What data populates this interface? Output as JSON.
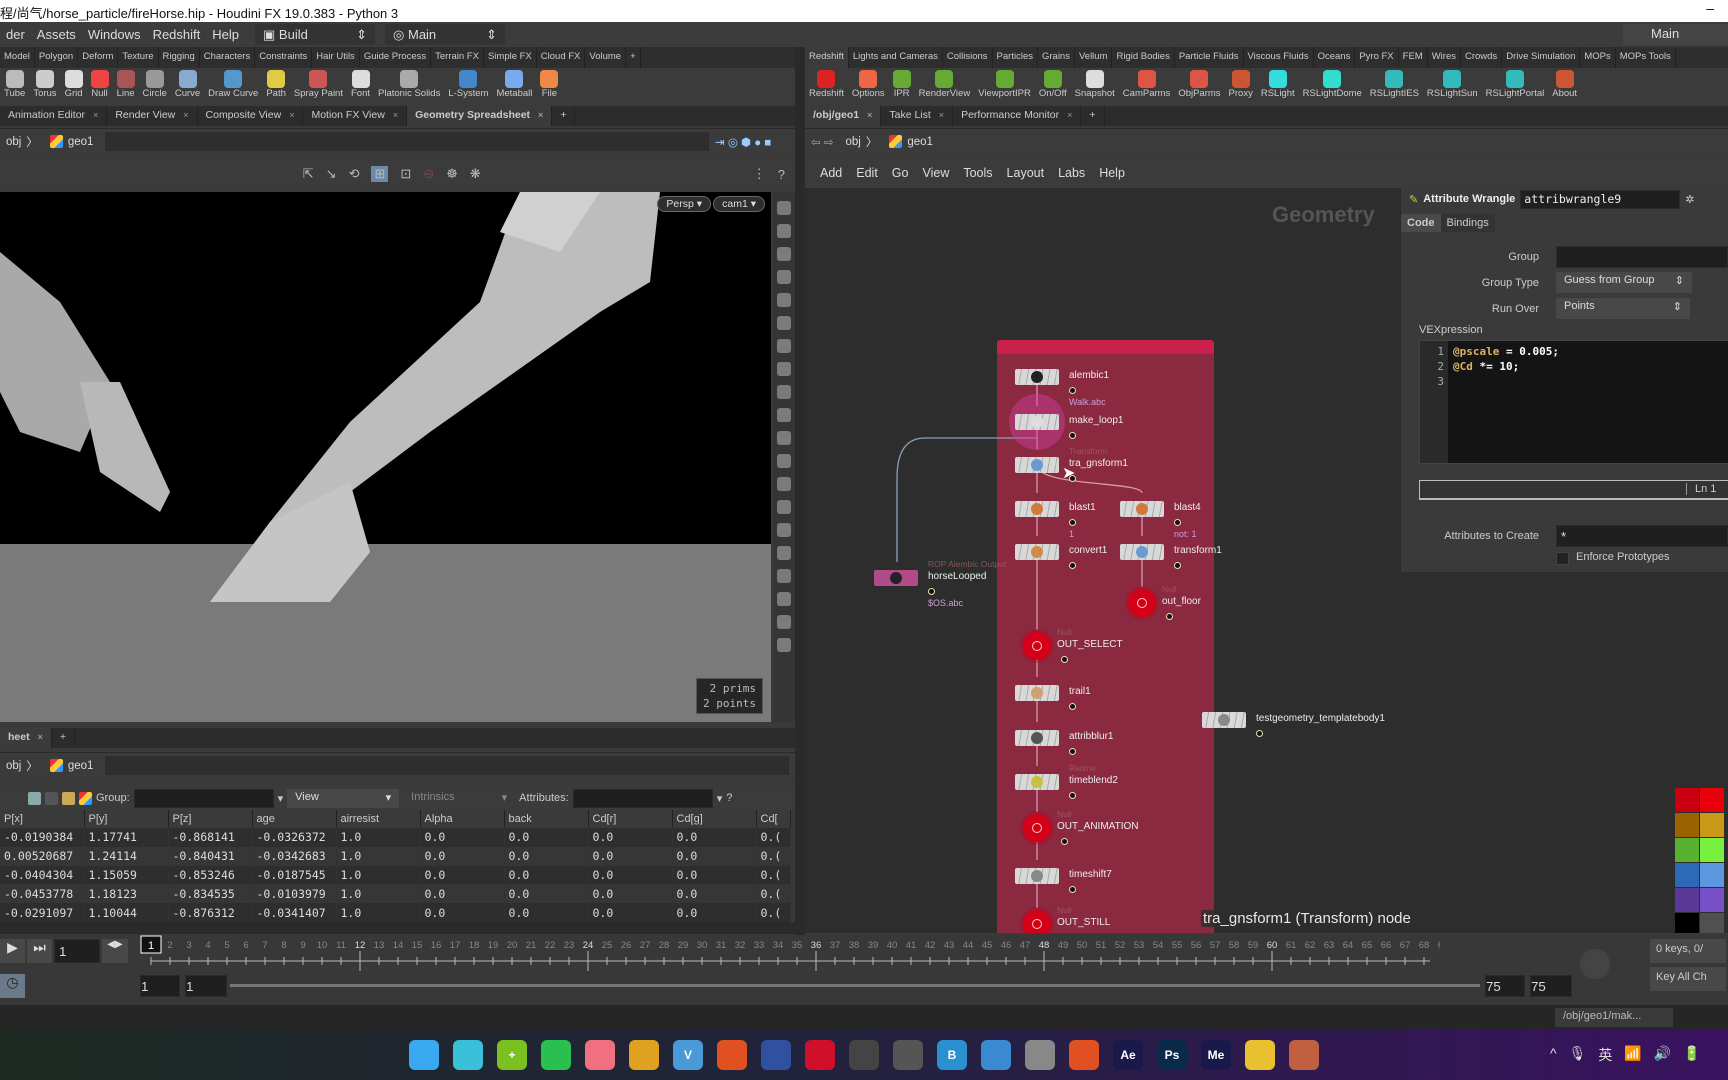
{
  "title": "程/尚气/horse_particle/fireHorse.hip - Houdini FX 19.0.383 - Python 3",
  "menu": [
    "der",
    "Assets",
    "Windows",
    "Redshift",
    "Help"
  ],
  "desktops": {
    "left": "Build",
    "center": "Main",
    "right": "Main"
  },
  "shelf_left": {
    "tabs": [
      "Model",
      "Polygon",
      "Deform",
      "Texture",
      "Rigging",
      "Characters",
      "Constraints",
      "Hair Utils",
      "Guide Process",
      "Terrain FX",
      "Simple FX",
      "Cloud FX",
      "Volume"
    ],
    "tools": [
      "Tube",
      "Torus",
      "Grid",
      "Null",
      "Line",
      "Circle",
      "Curve",
      "Draw Curve",
      "Path",
      "Spray Paint",
      "Font",
      "Platonic Solids",
      "L-System",
      "Metaball",
      "File"
    ]
  },
  "shelf_right": {
    "tabs": [
      "Redshift",
      "Lights and Cameras",
      "Collisions",
      "Particles",
      "Grains",
      "Vellum",
      "Rigid Bodies",
      "Particle Fluids",
      "Viscous Fluids",
      "Oceans",
      "Pyro FX",
      "FEM",
      "Wires",
      "Crowds",
      "Drive Simulation",
      "MOPs",
      "MOPs Tools"
    ],
    "tools": [
      "Redshift",
      "Options",
      "IPR",
      "RenderView",
      "ViewportIPR",
      "On/Off",
      "Snapshot",
      "CamParms",
      "ObjParms",
      "Proxy",
      "RSLight",
      "RSLightDome",
      "RSLightIES",
      "RSLightSun",
      "RSLightPortal",
      "About"
    ]
  },
  "pane_tabs_left": [
    "Animation Editor",
    "Render View",
    "Composite View",
    "Motion FX View",
    "Geometry Spreadsheet"
  ],
  "pane_tabs_right": [
    "/obj/geo1",
    "Take List",
    "Performance Monitor"
  ],
  "path": {
    "root": "obj",
    "node": "geo1"
  },
  "viewport": {
    "persp": "Persp ▾",
    "camera": "cam1 ▾",
    "info_prims": "2  prims",
    "info_points": "2 points"
  },
  "spreadsheet": {
    "tab": "heet",
    "group_label": "Group:",
    "view_label": "View",
    "intrinsics_label": "Intrinsics",
    "attributes_label": "Attributes:",
    "columns": [
      "P[x]",
      "P[y]",
      "P[z]",
      "age",
      "airresist",
      "Alpha",
      "back",
      "Cd[r]",
      "Cd[g]",
      "Cd["
    ],
    "rows": [
      [
        "-0.0190384",
        "1.17741",
        "-0.868141",
        "-0.0326372",
        "1.0",
        "0.0",
        "0.0",
        "0.0",
        "0.0",
        "0.("
      ],
      [
        "0.00520687",
        "1.24114",
        "-0.840431",
        "-0.0342683",
        "1.0",
        "0.0",
        "0.0",
        "0.0",
        "0.0",
        "0.("
      ],
      [
        "-0.0404304",
        "1.15059",
        "-0.853246",
        "-0.0187545",
        "1.0",
        "0.0",
        "0.0",
        "0.0",
        "0.0",
        "0.("
      ],
      [
        "-0.0453778",
        "1.18123",
        "-0.834535",
        "-0.0103979",
        "1.0",
        "0.0",
        "0.0",
        "0.0",
        "0.0",
        "0.("
      ],
      [
        "-0.0291097",
        "1.10044",
        "-0.876312",
        "-0.0341407",
        "1.0",
        "0.0",
        "0.0",
        "0.0",
        "0.0",
        "0.("
      ]
    ]
  },
  "network": {
    "menu": [
      "Add",
      "Edit",
      "Go",
      "View",
      "Tools",
      "Layout",
      "Labs",
      "Help"
    ],
    "context_label": "Geometry",
    "tooltip": "tra_gnsform1 (Transform) node",
    "nodes": [
      {
        "name": "alembic1",
        "type": "",
        "sub": "Walk.abc",
        "kind": "box",
        "icon": "#222"
      },
      {
        "name": "make_loop1",
        "type": "",
        "sub": "",
        "kind": "box",
        "icon": "#ddd"
      },
      {
        "name": "tra_gnsform1",
        "type": "Transform",
        "sub": "",
        "kind": "box",
        "icon": "#6a9bd0"
      },
      {
        "name": "blast1",
        "type": "",
        "sub": "1",
        "kind": "box",
        "icon": "#d07a3a"
      },
      {
        "name": "convert1",
        "type": "",
        "sub": "",
        "kind": "box",
        "icon": "#d08a4a"
      },
      {
        "name": "OUT_SELECT",
        "type": "Null",
        "sub": "",
        "kind": "null"
      },
      {
        "name": "trail1",
        "type": "",
        "sub": "",
        "kind": "box",
        "icon": "#d0a070"
      },
      {
        "name": "attribblur1",
        "type": "",
        "sub": "",
        "kind": "box",
        "icon": "#555"
      },
      {
        "name": "timeblend2",
        "type": "Retime",
        "sub": "",
        "kind": "box",
        "icon": "#c8c040"
      },
      {
        "name": "OUT_ANIMATION",
        "type": "Null",
        "sub": "",
        "kind": "null"
      },
      {
        "name": "timeshift7",
        "type": "",
        "sub": "",
        "kind": "box",
        "icon": "#888"
      },
      {
        "name": "OUT_STILL",
        "type": "Null",
        "sub": "",
        "kind": "null"
      },
      {
        "name": "blast4",
        "type": "",
        "sub": "not: 1",
        "kind": "box",
        "icon": "#d07a3a"
      },
      {
        "name": "transform1",
        "type": "",
        "sub": "",
        "kind": "box",
        "icon": "#6a9bd0"
      },
      {
        "name": "out_floor",
        "type": "Null",
        "sub": "",
        "kind": "null"
      },
      {
        "name": "horseLooped",
        "type": "ROP Alembic Output",
        "sub": "$OS.abc",
        "kind": "rop",
        "icon": "#222"
      },
      {
        "name": "testgeometry_templatebody1",
        "type": "",
        "sub": "",
        "kind": "box",
        "icon": "#888"
      }
    ]
  },
  "params": {
    "node_type": "Attribute Wrangle",
    "node_name": "attribwrangle9",
    "tabs": [
      "Code",
      "Bindings"
    ],
    "group_label": "Group",
    "group_value": "",
    "group_type_label": "Group Type",
    "group_type_value": "Guess from Group",
    "run_over_label": "Run Over",
    "run_over_value": "Points",
    "vex_label": "VEXpression",
    "code_lines": [
      {
        "n": "1",
        "attr": "@pscale",
        "rest": " = 0.005;"
      },
      {
        "n": "2",
        "attr": "@Cd",
        "rest": " *= 10;"
      },
      {
        "n": "3",
        "attr": "",
        "rest": ""
      }
    ],
    "ln_label": "Ln 1",
    "attrs_create_label": "Attributes to Create",
    "attrs_create_value": "*",
    "enforce_label": "Enforce Prototypes",
    "enforce_checked": false
  },
  "swatches": [
    "#c8000f",
    "#e8000c",
    "#9a6200",
    "#c89818",
    "#58b030",
    "#78f040",
    "#2c6ab8",
    "#5c98e0",
    "#5a3898",
    "#7850c8",
    "#000000",
    "#505050"
  ],
  "timeline": {
    "current_frame": "1",
    "start": 1,
    "end": 75,
    "range_start_a": "1",
    "range_start_b": "1",
    "range_end_a": "75",
    "range_end_b": "75",
    "keys_label": "0 keys, 0/",
    "key_all_label": "Key All Ch"
  },
  "status": {
    "path": "/obj/geo1/mak..."
  },
  "taskbar": {
    "icons": [
      {
        "name": "windows-start",
        "color": "#3aa8f0",
        "label": ""
      },
      {
        "name": "desktop",
        "color": "#3ac0d8",
        "label": ""
      },
      {
        "name": "360",
        "color": "#7ac020",
        "label": "+"
      },
      {
        "name": "wechat",
        "color": "#2ac050",
        "label": ""
      },
      {
        "name": "app-tiles",
        "color": "#f07080",
        "label": ""
      },
      {
        "name": "chrome",
        "color": "#e0a020",
        "label": ""
      },
      {
        "name": "v-app",
        "color": "#4a9ad8",
        "label": "V"
      },
      {
        "name": "houdini",
        "color": "#e05020",
        "label": ""
      },
      {
        "name": "cinema4d",
        "color": "#3050a0",
        "label": ""
      },
      {
        "name": "netease-music",
        "color": "#d0102a",
        "label": ""
      },
      {
        "name": "obs",
        "color": "#444",
        "label": ""
      },
      {
        "name": "search-tool",
        "color": "#555",
        "label": ""
      },
      {
        "name": "notes",
        "color": "#2a90d0",
        "label": "B"
      },
      {
        "name": "browser",
        "color": "#3a8ad0",
        "label": ""
      },
      {
        "name": "power",
        "color": "#888",
        "label": ""
      },
      {
        "name": "houdini-active",
        "color": "#e05020",
        "label": ""
      },
      {
        "name": "after-effects",
        "color": "#1a1a4a",
        "label": "Ae"
      },
      {
        "name": "photoshop",
        "color": "#0a2a4a",
        "label": "Ps"
      },
      {
        "name": "media-encoder",
        "color": "#1a1a4a",
        "label": "Me"
      },
      {
        "name": "file-explorer",
        "color": "#e8c030",
        "label": ""
      },
      {
        "name": "chrome-alt",
        "color": "#c06040",
        "label": ""
      }
    ],
    "tray": [
      "^",
      "🎙",
      "英",
      "📶",
      "🔊",
      "🔋"
    ]
  }
}
